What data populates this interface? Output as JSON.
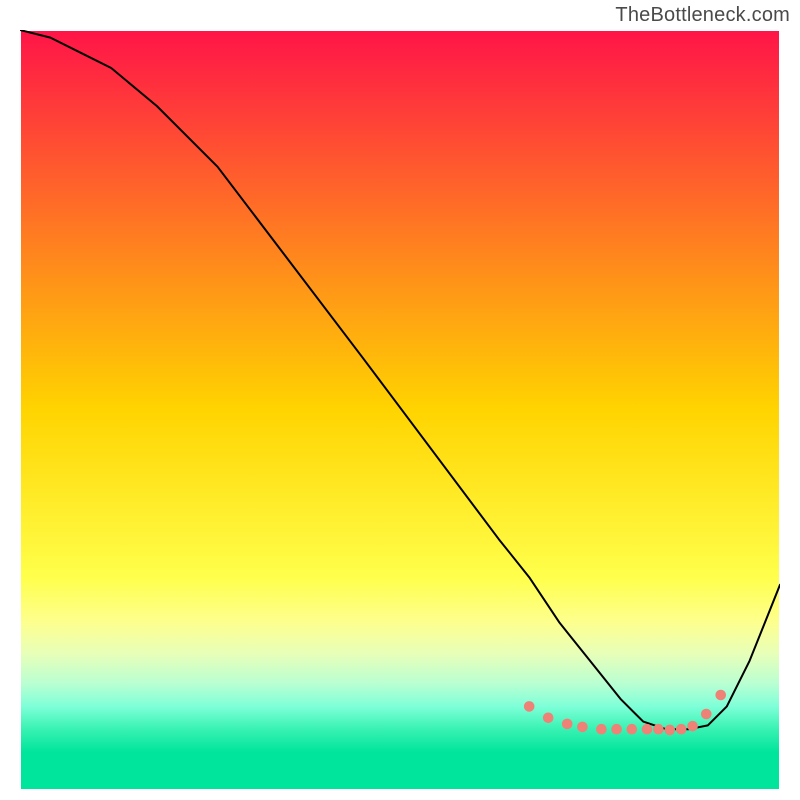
{
  "watermark": "TheBottleneck.com",
  "chart_data": {
    "type": "line",
    "xlim": [
      0,
      100
    ],
    "ylim": [
      0,
      100
    ],
    "grid": false,
    "legend": false,
    "title": "",
    "xlabel": "",
    "ylabel": "",
    "background_gradient": {
      "stops": [
        {
          "pos": 0.0,
          "color": "#ff1448"
        },
        {
          "pos": 0.5,
          "color": "#ffd400"
        },
        {
          "pos": 0.72,
          "color": "#ffff4b"
        },
        {
          "pos": 0.78,
          "color": "#fdff8f"
        },
        {
          "pos": 0.82,
          "color": "#e8ffb8"
        },
        {
          "pos": 0.86,
          "color": "#b9ffd2"
        },
        {
          "pos": 0.89,
          "color": "#7effd8"
        },
        {
          "pos": 0.92,
          "color": "#38f2b2"
        },
        {
          "pos": 0.95,
          "color": "#00e59c"
        },
        {
          "pos": 1.0,
          "color": "#00e59c"
        }
      ]
    },
    "series": [
      {
        "name": "bottleneck-curve",
        "x": [
          0,
          4,
          8,
          12,
          18,
          26,
          45,
          63,
          67,
          71,
          75,
          79,
          82,
          85,
          88,
          90.5,
          93,
          96,
          100
        ],
        "y": [
          100,
          99,
          97,
          95,
          90,
          82,
          57,
          33,
          28,
          22,
          17,
          12,
          9,
          8,
          8,
          8.5,
          11,
          17,
          27
        ],
        "stroke": "#000000",
        "stroke_width": 2,
        "marker": "none"
      },
      {
        "name": "optimal-dots",
        "x": [
          67,
          69.5,
          72,
          74,
          76.5,
          78.5,
          80.5,
          82.5,
          84,
          85.5,
          87,
          88.5,
          90.3,
          92.2
        ],
        "y": [
          11,
          9.5,
          8.7,
          8.3,
          8.0,
          8.0,
          8.0,
          8.0,
          8.0,
          7.9,
          8.0,
          8.4,
          10.0,
          12.5
        ],
        "stroke": "none",
        "marker": "circle",
        "marker_color": "#ef8277",
        "marker_r": 5.3
      }
    ]
  }
}
